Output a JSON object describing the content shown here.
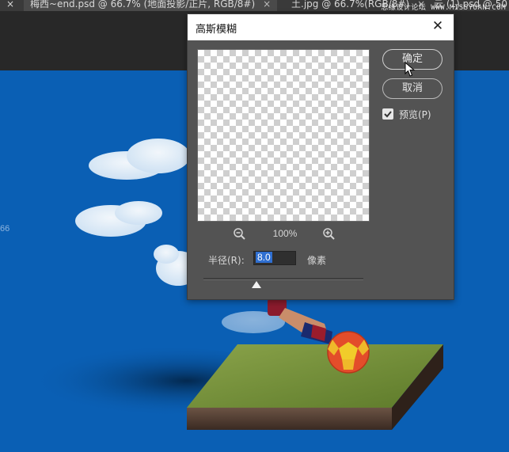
{
  "tabs": [
    {
      "label": "梅西~end.psd @ 66.7% (地面投影/正片, RGB/8#)",
      "close": "×"
    },
    {
      "label": "土.jpg @ 66.7%(RGB/8#)",
      "close": "×"
    },
    {
      "label": "云 (1).psd @ 50",
      "close": ""
    }
  ],
  "tab_leading_close": "×",
  "watermark": "思缘设计论坛 WWW.MISSYUAN.COM",
  "canvas_side_number": "66",
  "dialog": {
    "title": "高斯模糊",
    "close": "✕",
    "ok_label": "确定",
    "cancel_label": "取消",
    "preview_label": "预览(P)",
    "preview_checked": true,
    "zoom_value": "100%",
    "radius_label": "半径(R):",
    "radius_value": "8.0",
    "radius_unit": "像素",
    "radius_slider_fraction": 0.33
  },
  "colors": {
    "canvas_blue": "#0a5fb4",
    "dialog_bg": "#535353",
    "input_selection": "#2f6fd1"
  },
  "icons": {
    "zoom_out": "zoom-out-icon",
    "zoom_in": "zoom-in-icon",
    "close": "close-icon",
    "checkbox": "checkmark-icon",
    "cursor": "mouse-pointer-icon"
  }
}
